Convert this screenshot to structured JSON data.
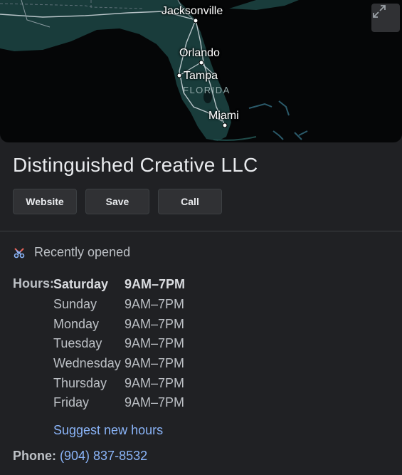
{
  "map": {
    "cities": {
      "jacksonville": "Jacksonville",
      "orlando": "Orlando",
      "tampa": "Tampa",
      "miami": "Miami"
    },
    "state_label": "FLORIDA",
    "expand_icon": "expand-icon"
  },
  "business": {
    "name": "Distinguished Creative LLC"
  },
  "actions": {
    "website": "Website",
    "save": "Save",
    "call": "Call"
  },
  "status": {
    "icon": "ribbon-scissors-icon",
    "text": "Recently opened"
  },
  "hours": {
    "label": "Hours:",
    "rows": [
      {
        "day": "Saturday",
        "time": "9AM–7PM"
      },
      {
        "day": "Sunday",
        "time": "9AM–7PM"
      },
      {
        "day": "Monday",
        "time": "9AM–7PM"
      },
      {
        "day": "Tuesday",
        "time": "9AM–7PM"
      },
      {
        "day": "Wednesday",
        "time": "9AM–7PM"
      },
      {
        "day": "Thursday",
        "time": "9AM–7PM"
      },
      {
        "day": "Friday",
        "time": "9AM–7PM"
      }
    ],
    "suggest_link": "Suggest new hours"
  },
  "phone": {
    "label": "Phone:",
    "number": "(904) 837-8532"
  },
  "colors": {
    "background": "#202124",
    "link": "#8ab4f8",
    "land": "#193c3b",
    "button": "#303134"
  }
}
